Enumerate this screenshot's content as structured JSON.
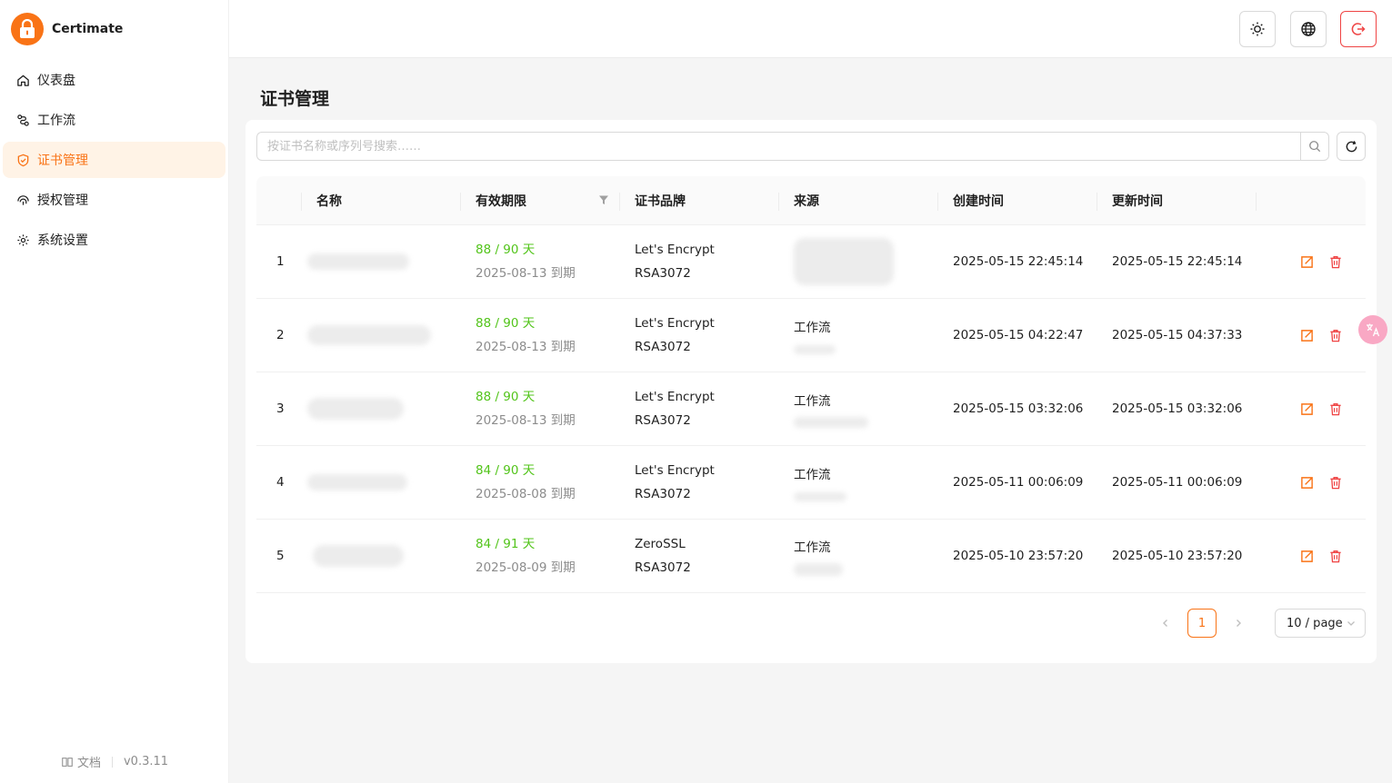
{
  "app": {
    "name": "Certimate",
    "version": "v0.3.11",
    "docs_label": "文档"
  },
  "sidebar": {
    "items": [
      {
        "label": "仪表盘",
        "icon": "home-icon"
      },
      {
        "label": "工作流",
        "icon": "workflow-icon"
      },
      {
        "label": "证书管理",
        "icon": "shield-check-icon",
        "active": true
      },
      {
        "label": "授权管理",
        "icon": "fingerprint-icon"
      },
      {
        "label": "系统设置",
        "icon": "gear-icon"
      }
    ]
  },
  "header": {
    "buttons": [
      "theme-toggle",
      "language",
      "logout"
    ]
  },
  "page": {
    "title": "证书管理"
  },
  "search": {
    "placeholder": "按证书名称或序列号搜索……"
  },
  "table": {
    "columns": [
      "名称",
      "有效期限",
      "证书品牌",
      "来源",
      "创建时间",
      "更新时间"
    ],
    "rows": [
      {
        "index": "1",
        "valid_days": "88 / 90 天",
        "expires": "2025-08-13 到期",
        "brand": "Let's Encrypt",
        "algo": "RSA3072",
        "source": "",
        "created": "2025-05-15 22:45:14",
        "updated": "2025-05-15 22:45:14"
      },
      {
        "index": "2",
        "valid_days": "88 / 90 天",
        "expires": "2025-08-13 到期",
        "brand": "Let's Encrypt",
        "algo": "RSA3072",
        "source": "工作流",
        "created": "2025-05-15 04:22:47",
        "updated": "2025-05-15 04:37:33"
      },
      {
        "index": "3",
        "valid_days": "88 / 90 天",
        "expires": "2025-08-13 到期",
        "brand": "Let's Encrypt",
        "algo": "RSA3072",
        "source": "工作流",
        "created": "2025-05-15 03:32:06",
        "updated": "2025-05-15 03:32:06"
      },
      {
        "index": "4",
        "valid_days": "84 / 90 天",
        "expires": "2025-08-08 到期",
        "brand": "Let's Encrypt",
        "algo": "RSA3072",
        "source": "工作流",
        "created": "2025-05-11 00:06:09",
        "updated": "2025-05-11 00:06:09"
      },
      {
        "index": "5",
        "valid_days": "84 / 91 天",
        "expires": "2025-08-09 到期",
        "brand": "ZeroSSL",
        "algo": "RSA3072",
        "source": "工作流",
        "created": "2025-05-10 23:57:20",
        "updated": "2025-05-10 23:57:20"
      }
    ]
  },
  "pagination": {
    "current": "1",
    "page_size": "10 / page"
  },
  "colors": {
    "accent": "#f97316",
    "success": "#52c41a",
    "danger": "#ef4444"
  }
}
